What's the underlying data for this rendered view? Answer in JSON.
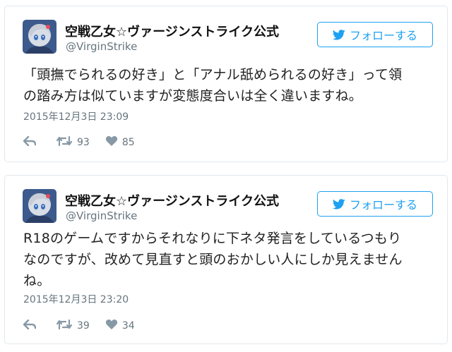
{
  "tweets": [
    {
      "account_name": "空戦乙女☆ヴァージンストライク公式",
      "handle": "@VirginStrike",
      "follow_label": "フォローする",
      "text_lines": [
        "「頭撫でられるの好き」と「アナル舐められるの好き」って領",
        "の踏み方は似ていますが変態度合いは全く違いますね。"
      ],
      "date": "2015年12月3日 23:09",
      "retweets": "93",
      "likes": "85"
    },
    {
      "account_name": "空戦乙女☆ヴァージンストライク公式",
      "handle": "@VirginStrike",
      "follow_label": "フォローする",
      "text_lines": [
        "R18のゲームですからそれなりに下ネタ発言をしているつもり",
        "なのですが、改めて見直すと頭のおかしい人にしか見えません",
        "ね。"
      ],
      "date": "2015年12月3日 23:20",
      "retweets": "39",
      "likes": "34"
    }
  ],
  "colors": {
    "accent": "#1da1f2",
    "muted": "#66757f",
    "icon": "#8899a6",
    "border": "#e1e8ed"
  },
  "icons": [
    "twitter-bird-icon",
    "reply-icon",
    "retweet-icon",
    "heart-icon"
  ]
}
